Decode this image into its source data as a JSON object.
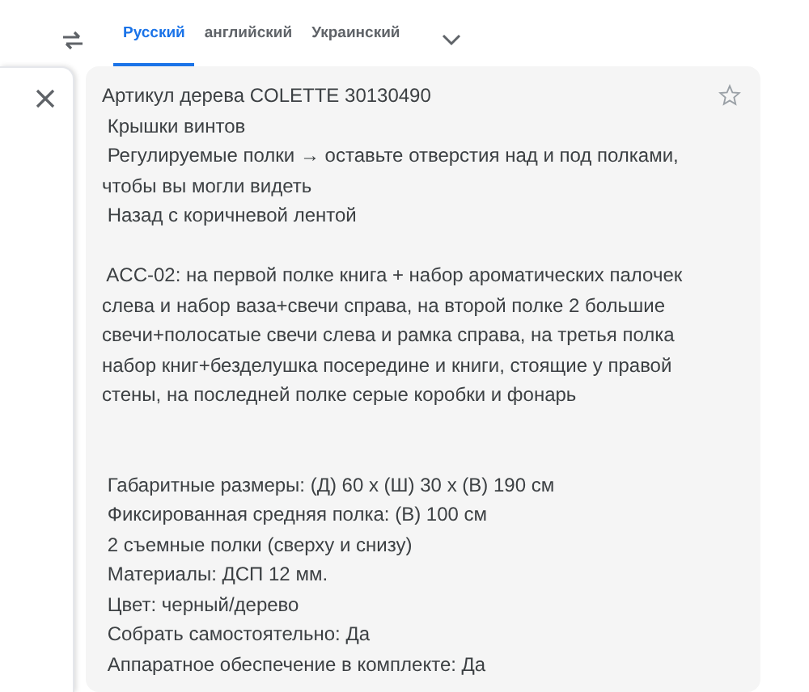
{
  "language_tabs": [
    {
      "label": "Русский",
      "selected": true
    },
    {
      "label": "английский",
      "selected": false
    },
    {
      "label": "Украинский",
      "selected": false
    }
  ],
  "translation": {
    "blocks": [
      {
        "lines": [
          "Артикул дерева COLETTE 30130490",
          " Крышки винтов",
          " Регулируемые полки → оставьте отверстия над и под полками,",
          "чтобы вы могли видеть",
          " Назад с коричневой лентой"
        ]
      },
      {
        "lines": [
          " ACC-02: на первой полке книга + набор ароматических палочек",
          "слева и набор ваза+свечи справа, на второй полке 2 большие",
          "свечи+полосатые свечи слева и рамка справа, на третья полка",
          "набор книг+безделушка посередине и книги, стоящие у правой",
          "стены, на последней полке серые коробки и фонарь"
        ]
      },
      {
        "lines": [
          " Габаритные размеры: (Д) 60 x (Ш) 30 x (В) 190 см",
          " Фиксированная средняя полка: (В) 100 см",
          " 2 съемные полки (сверху и снизу)",
          " Материалы: ДСП 12 мм.",
          " Цвет: черный/дерево",
          " Собрать самостоятельно: Да",
          " Аппаратное обеспечение в комплекте: Да"
        ]
      }
    ]
  }
}
